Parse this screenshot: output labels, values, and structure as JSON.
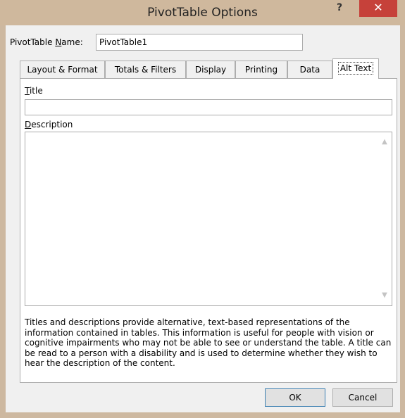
{
  "window": {
    "title": "PivotTable Options",
    "help_label": "?",
    "close_label": "✕"
  },
  "name_field": {
    "label_pre": "PivotTable ",
    "label_underline": "N",
    "label_post": "ame:",
    "value": "PivotTable1"
  },
  "tabs": [
    {
      "label": "Layout & Format"
    },
    {
      "label": "Totals & Filters"
    },
    {
      "label": "Display"
    },
    {
      "label": "Printing"
    },
    {
      "label": "Data"
    },
    {
      "label": "Alt Text"
    }
  ],
  "alt_text": {
    "title_label_underline": "T",
    "title_label_rest": "itle",
    "title_value": "",
    "description_label_underline": "D",
    "description_label_rest": "escription",
    "description_value": "",
    "help_text": "Titles and descriptions provide alternative, text-based representations of the information contained in tables. This information is useful for people with vision or cognitive impairments who may not be able to see or understand the table.  A title can be read to a person with a disability and is used to determine whether they wish to hear the description of the content."
  },
  "buttons": {
    "ok": "OK",
    "cancel": "Cancel"
  }
}
